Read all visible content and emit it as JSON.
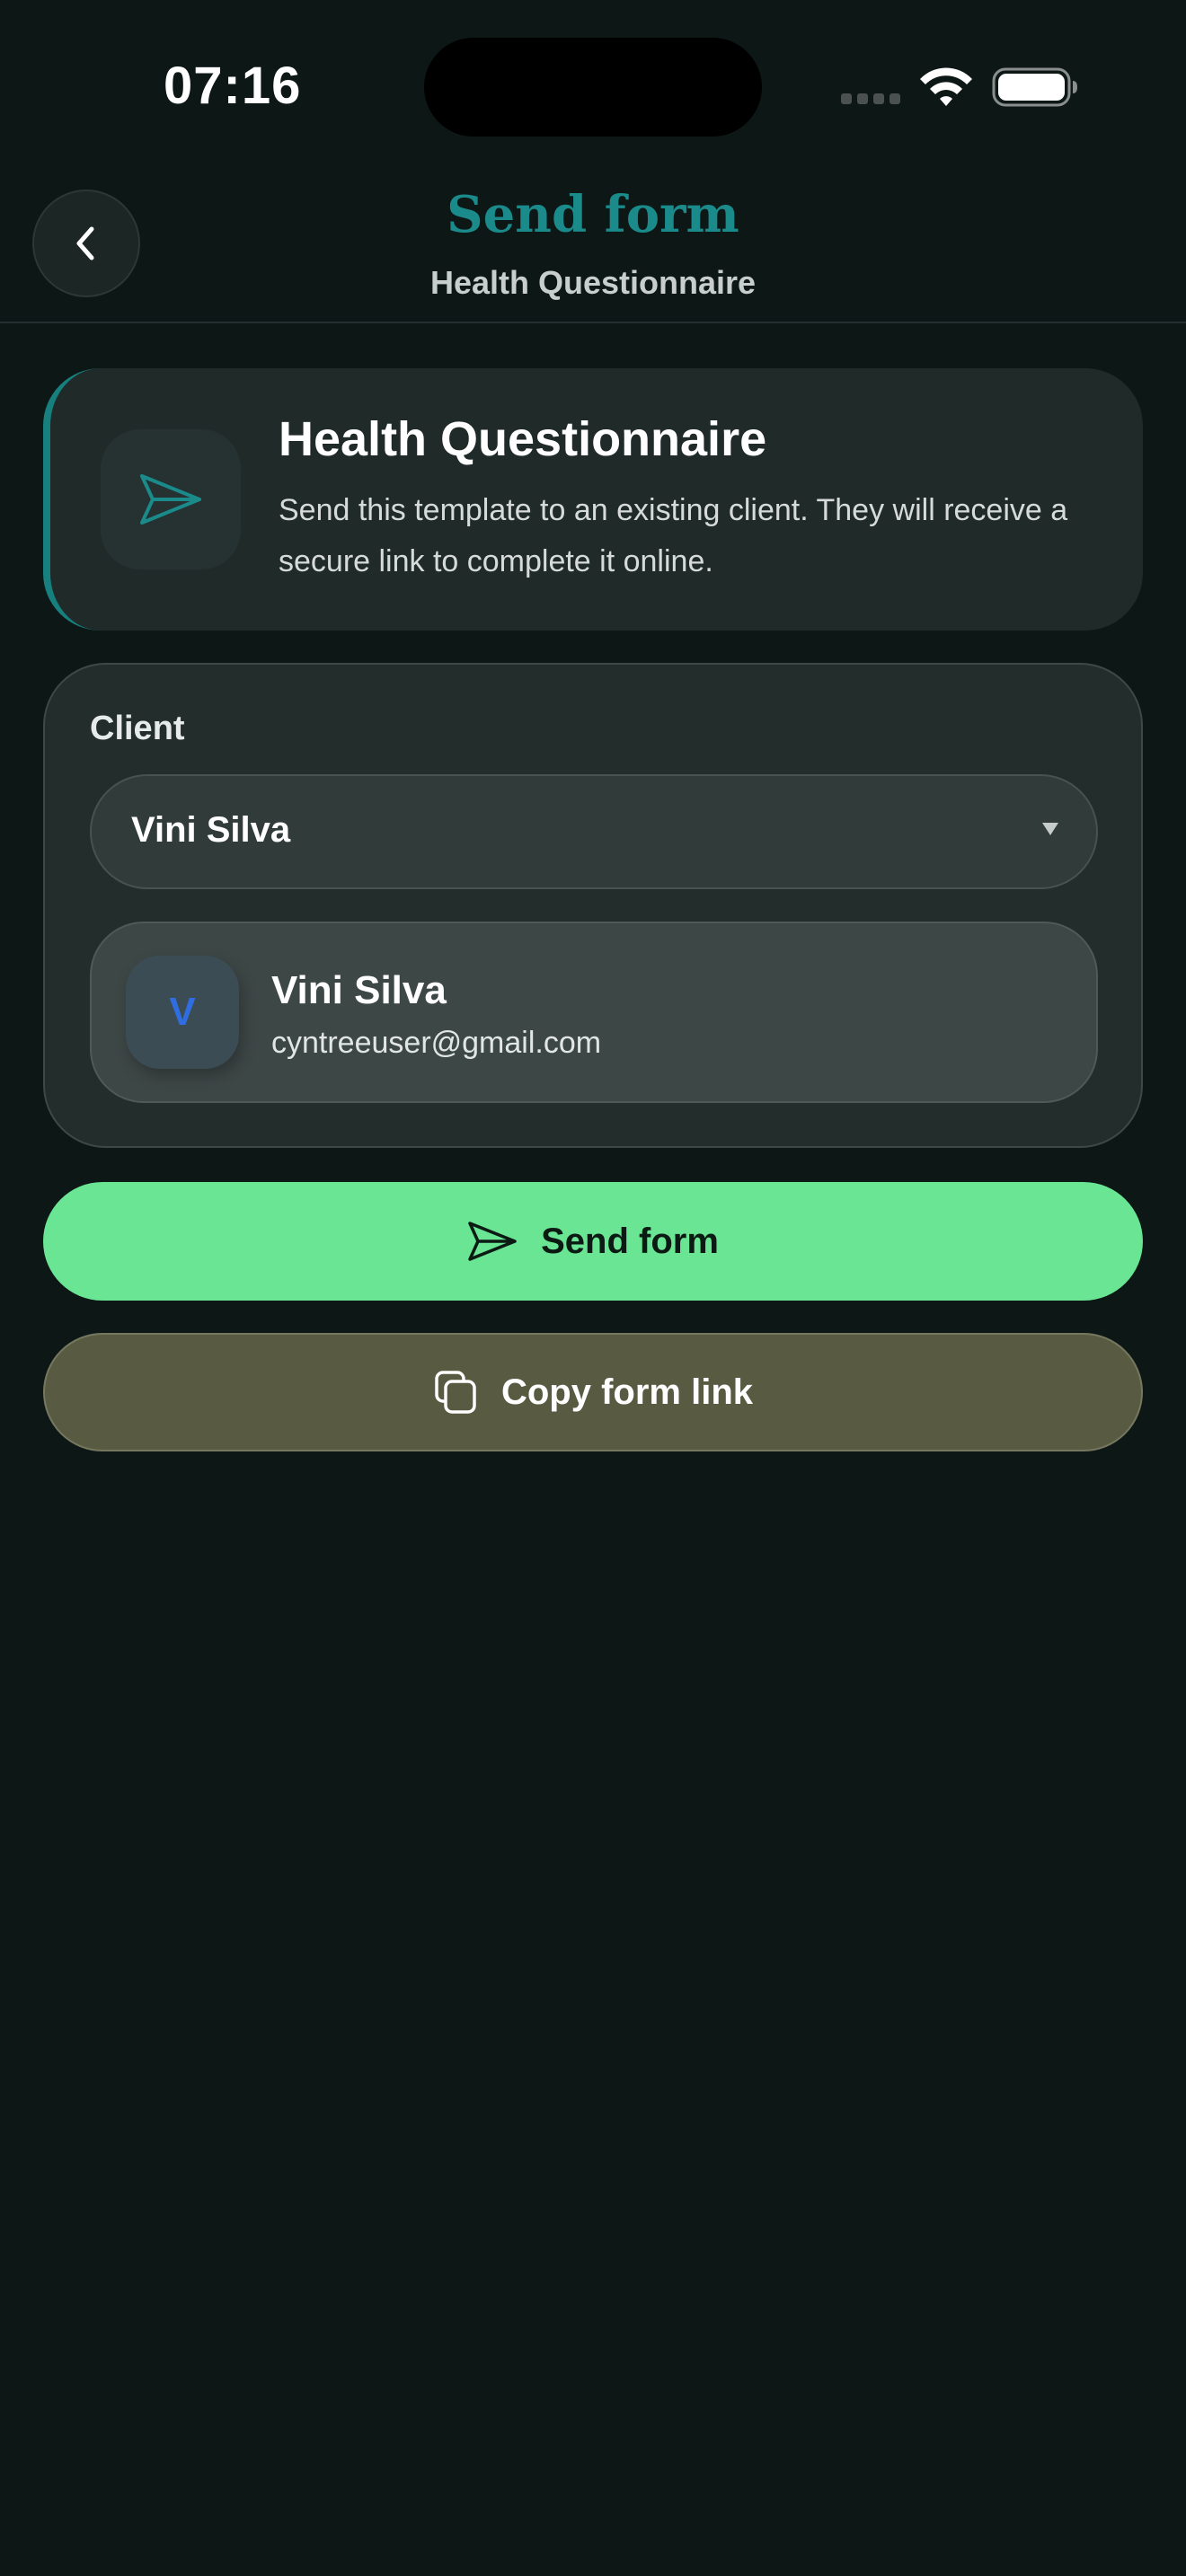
{
  "status_bar": {
    "time": "07:16"
  },
  "header": {
    "title": "Send form",
    "subtitle": "Health Questionnaire"
  },
  "template_card": {
    "title": "Health Questionnaire",
    "description": "Send this template to an existing client. They will receive a secure link to complete it online.",
    "icon": "send-icon"
  },
  "client_section": {
    "label": "Client",
    "selected_value": "Vini Silva",
    "client": {
      "avatar_initial": "V",
      "name": "Vini Silva",
      "email": "cyntreeuser@gmail.com"
    }
  },
  "actions": {
    "send_label": "Send form",
    "copy_label": "Copy form link"
  },
  "colors": {
    "background": "#0d1716",
    "accent_teal": "#1a8a8a",
    "send_button": "#69e594",
    "copy_button": "#585b42",
    "avatar_initial": "#2f6de0"
  }
}
